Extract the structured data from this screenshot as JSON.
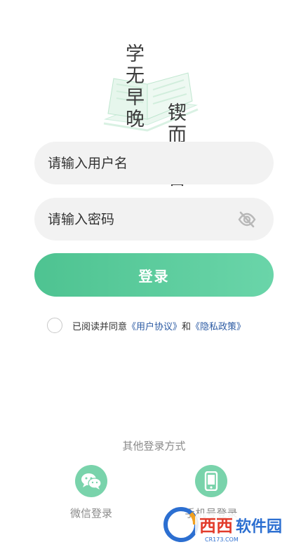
{
  "hero": {
    "slogan_line1": "学无早晚",
    "slogan_line2": "锲而不舍"
  },
  "login_form": {
    "username_placeholder": "请输入用户名",
    "password_placeholder": "请输入密码",
    "password_toggle_icon": "eye-off-icon",
    "login_button_label": "登录"
  },
  "agreement": {
    "checked": false,
    "prefix_text": "已阅读并同意",
    "user_agreement_link": "《用户协议》",
    "conjunction": "和",
    "privacy_policy_link": "《隐私政策》"
  },
  "other_login": {
    "title": "其他登录方式",
    "methods": [
      {
        "label": "微信登录",
        "icon": "wechat-icon"
      },
      {
        "label": "手机号登录",
        "icon": "phone-icon"
      }
    ]
  },
  "watermark": {
    "text": "西西软件园",
    "subtext": "CR173.COM"
  },
  "colors": {
    "accent": "#4ec391",
    "accent_light": "#79d3ab",
    "link": "#2b5aa3",
    "input_bg": "#f2f2f2"
  }
}
